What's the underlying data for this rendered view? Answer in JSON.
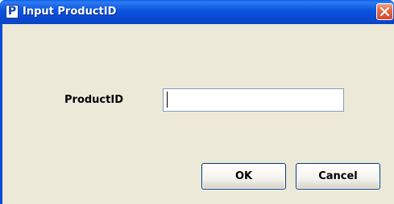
{
  "window": {
    "title": "Input ProductID",
    "icon_letter": "P",
    "icon_name": "app-p-icon",
    "close_icon": "close-icon"
  },
  "form": {
    "label": "ProductID",
    "input_value": "",
    "input_placeholder": ""
  },
  "buttons": {
    "ok_label": "OK",
    "cancel_label": "Cancel"
  },
  "colors": {
    "titlebar": "#0a49d3",
    "client_background": "#ece9d8",
    "close_button": "#e5683f",
    "input_border": "#7f9db9"
  }
}
